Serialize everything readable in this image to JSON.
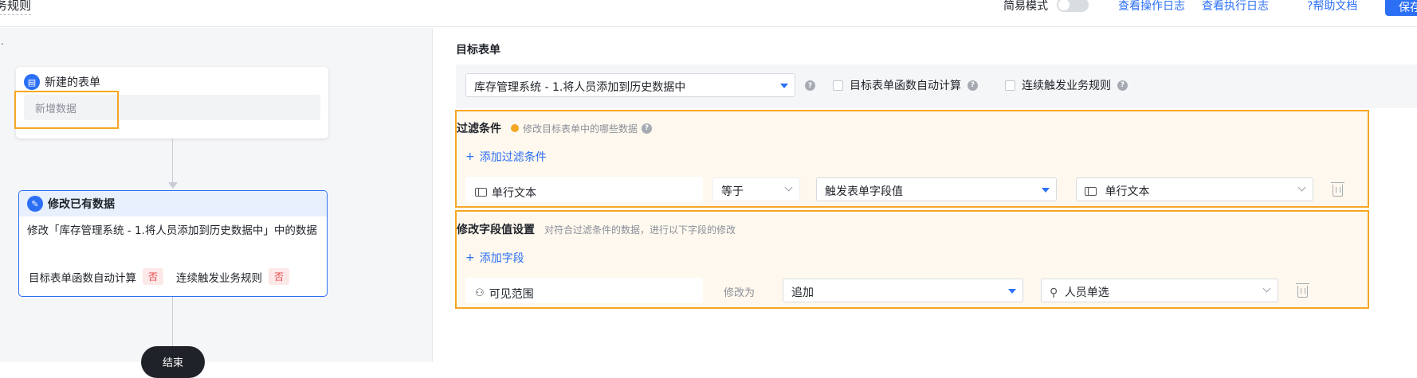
{
  "header": {
    "title": "务规则",
    "simple_mode_label": "简易模式",
    "operation_log": "查看操作日志",
    "execution_log": "查看执行日志",
    "help_doc": "帮助文档",
    "save_label": "保存"
  },
  "flow": {
    "dot": ".",
    "node1": {
      "title": "新建的表单",
      "body": "新增数据"
    },
    "node2": {
      "title": "修改已有数据",
      "desc": "修改「库存管理系统 - 1.将人员添加到历史数据中」中的数据",
      "flag1_label": "目标表单函数自动计算",
      "flag1_value": "否",
      "flag2_label": "连续触发业务规则",
      "flag2_value": "否"
    },
    "end_label": "结束"
  },
  "target": {
    "section_label": "目标表单",
    "form_value": "库存管理系统 - 1.将人员添加到历史数据中",
    "auto_calc_label": "目标表单函数自动计算",
    "chain_trigger_label": "连续触发业务规则"
  },
  "filter": {
    "section_label": "过滤条件",
    "hint": "修改目标表单中的哪些数据",
    "add_label": "添加过滤条件",
    "field": "单行文本",
    "operator": "等于",
    "value_type": "触发表单字段值",
    "value_field": "单行文本"
  },
  "modify": {
    "section_label": "修改字段值设置",
    "hint": "对符合过滤条件的数据，进行以下字段的修改",
    "add_label": "添加字段",
    "field": "可见范围",
    "modify_to": "修改为",
    "mode": "追加",
    "value_field": "人员单选"
  },
  "colors": {
    "accent": "#2b6ff5",
    "highlight": "#f5a623",
    "danger": "#e5484d"
  }
}
